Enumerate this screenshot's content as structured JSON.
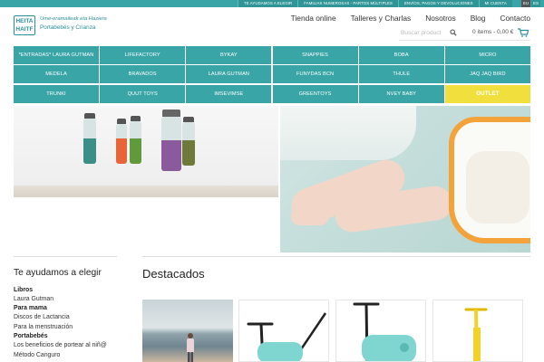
{
  "topbar": {
    "links": [
      "TE AYUDAMOS A ELEGIR",
      "FAMILIAS NUMEROSAS - PARTOS MÚLTIPLES",
      "ENVÍOS, PAGOS Y DEVOLUCIONES",
      "MI CUENTA"
    ],
    "lang_eu": "EU",
    "lang_es": "ES"
  },
  "logo": {
    "mark_line1": "HEITA",
    "mark_line2": "HAITF",
    "tagline": "Ume-eramaileak eta Haziera",
    "subtitle": "Portabebés y Crianza"
  },
  "nav": [
    "Tienda online",
    "Talleres y Charlas",
    "Nosotros",
    "Blog",
    "Contacto"
  ],
  "search": {
    "placeholder": "Buscar product"
  },
  "cart": {
    "text": "0 items - 0,00 €"
  },
  "brands": [
    "*ENTRADAS* LAURA GUTMAN",
    "LIFEFACTORY",
    "BYKAY",
    "SNAPPIES",
    "BOBA",
    "MICRO",
    "MEDELA",
    "BRAVADOS",
    "LAURA GUTMAN",
    "FUNYDAS BCN",
    "THULE",
    "JAQ JAQ BIRD",
    "TRUNKI",
    "QUUT TOYS",
    "IMSEVIMSE",
    "GREENTOYS",
    "NVEY BABY",
    "OUTLET"
  ],
  "sidebar": {
    "title": "Te ayudamos a elegir",
    "groups": [
      {
        "name": "Libros",
        "links": [
          "Laura Gutman"
        ]
      },
      {
        "name": "Para mama",
        "links": [
          "Discos de Lactancia",
          "Para la menstruación"
        ]
      },
      {
        "name": "Portabebés",
        "links": [
          "Los beneficios de portear al niñ@",
          "Método Canguro"
        ]
      }
    ]
  },
  "featured": {
    "title": "Destacados"
  },
  "colors": {
    "teal": "#3aa5a6",
    "outlet_yellow": "#f1df3d",
    "orange": "#f4a23a"
  }
}
